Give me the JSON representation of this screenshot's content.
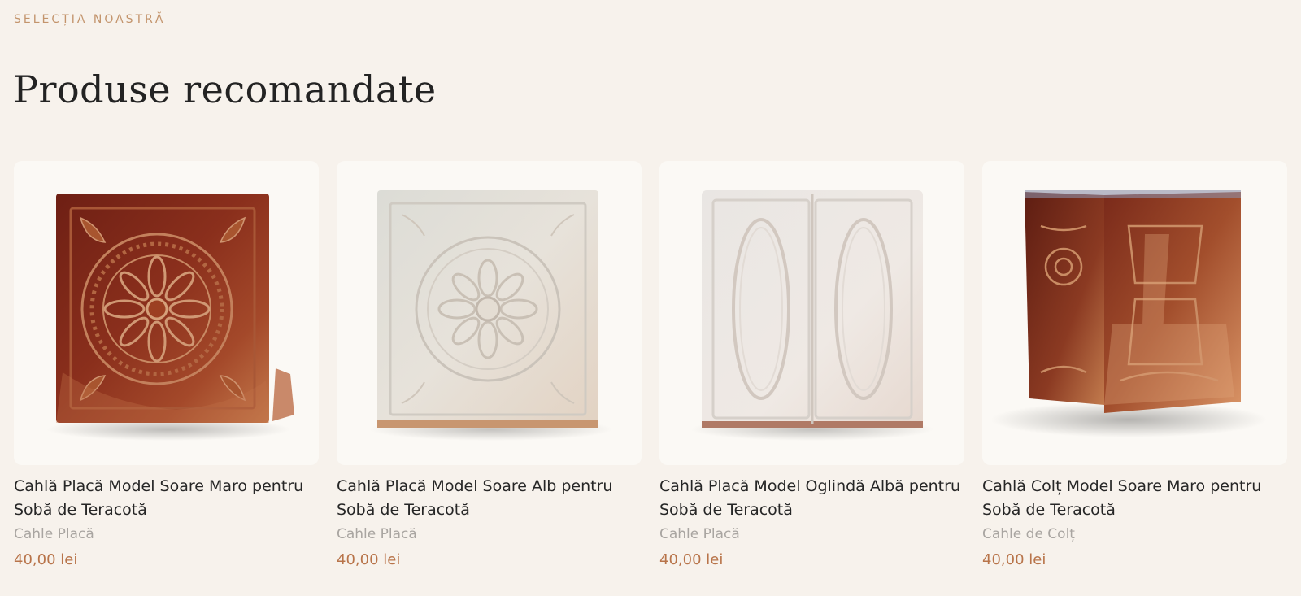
{
  "section": {
    "eyebrow": "SELECȚIA NOASTRĂ",
    "title": "Produse recomandate"
  },
  "colors": {
    "accent": "#c3946c",
    "price": "#b8744a",
    "background": "#f7f2ec"
  },
  "products": [
    {
      "title": "Cahlă Placă Model Soare Maro pentru Sobă de Teracotă",
      "category": "Cahle Placă",
      "price": "40,00 lei",
      "image": "brown-sun-tile-image"
    },
    {
      "title": "Cahlă Placă Model Soare Alb pentru Sobă de Teracotă",
      "category": "Cahle Placă",
      "price": "40,00 lei",
      "image": "white-sun-tile-image"
    },
    {
      "title": "Cahlă Placă Model Oglindă Albă pentru Sobă de Teracotă",
      "category": "Cahle Placă",
      "price": "40,00 lei",
      "image": "white-mirror-tile-image"
    },
    {
      "title": "Cahlă Colț Model Soare Maro pentru Sobă de Teracotă",
      "category": "Cahle de Colț",
      "price": "40,00 lei",
      "image": "brown-corner-tile-image"
    }
  ]
}
